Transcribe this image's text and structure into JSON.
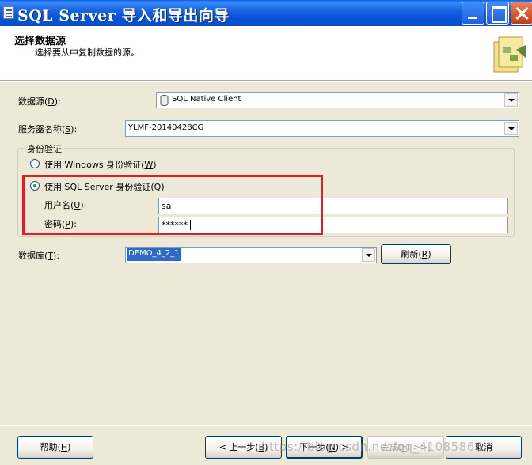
{
  "window": {
    "title": "SQL Server 导入和导出向导"
  },
  "header": {
    "title": "选择数据源",
    "subtitle": "选择要从中复制数据的源。"
  },
  "data_source": {
    "label": "数据源",
    "hotkey": "D",
    "value": "SQL Native Client",
    "icon": "database-icon"
  },
  "server": {
    "label": "服务器名称",
    "hotkey": "S",
    "value": "YLMF-20140428CG"
  },
  "auth": {
    "group_label": "身份验证",
    "windows_label_prefix": "使用 Windows 身份验证",
    "windows_hotkey": "W",
    "windows_checked": false,
    "sql_label_prefix": "使用 SQL Server 身份验证",
    "sql_hotkey": "Q",
    "sql_checked": true,
    "username_label": "用户名",
    "username_hotkey": "U",
    "username_value": "sa",
    "password_label": "密码",
    "password_hotkey": "P",
    "password_value": "******"
  },
  "database": {
    "label": "数据库",
    "hotkey": "T",
    "value": "DEMO_4_2_1",
    "refresh_label": "刷新",
    "refresh_hotkey": "R"
  },
  "buttons": {
    "help": "帮助",
    "help_hotkey": "H",
    "back": "< 上一步",
    "back_hotkey": "B",
    "next": "下一步",
    "next_hotkey": "N",
    "finish": "完成",
    "finish_hotkey": "F",
    "cancel": "取消"
  },
  "watermark": "https://blog.csdn.net/qq_41085868",
  "colors": {
    "highlight": "#e41d24",
    "titlebar": "#0653d6",
    "selection": "#316ac5"
  }
}
